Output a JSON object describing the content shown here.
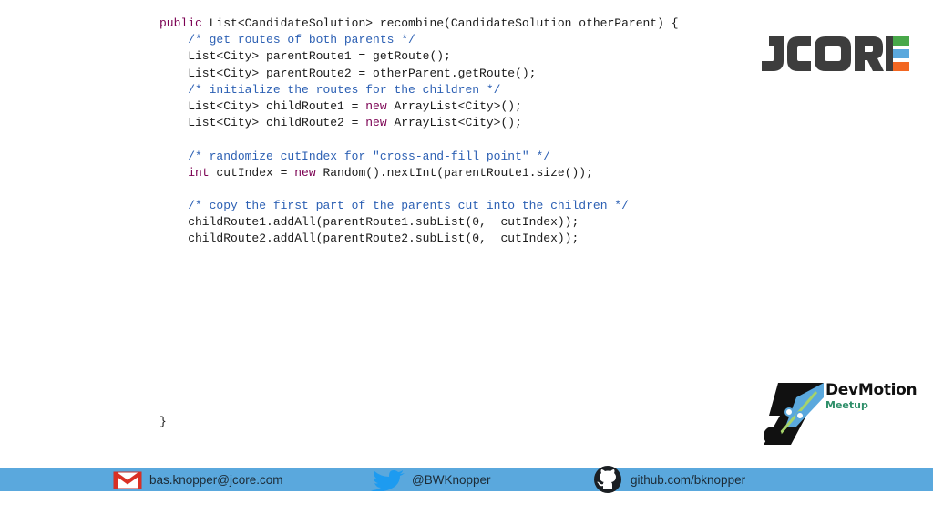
{
  "code": {
    "lines": [
      [
        {
          "t": "public",
          "c": "kw"
        },
        {
          "t": " List<CandidateSolution> recombine(CandidateSolution otherParent) {",
          "c": "tx"
        }
      ],
      [
        {
          "t": "    ",
          "c": "tx"
        },
        {
          "t": "/* get routes of both parents */",
          "c": "cm"
        }
      ],
      [
        {
          "t": "    List<City> parentRoute1 = getRoute();",
          "c": "tx"
        }
      ],
      [
        {
          "t": "    List<City> parentRoute2 = otherParent.getRoute();",
          "c": "tx"
        }
      ],
      [
        {
          "t": "    ",
          "c": "tx"
        },
        {
          "t": "/* initialize the routes for the children */",
          "c": "cm"
        }
      ],
      [
        {
          "t": "    List<City> childRoute1 = ",
          "c": "tx"
        },
        {
          "t": "new",
          "c": "kw"
        },
        {
          "t": " ArrayList<City>();",
          "c": "tx"
        }
      ],
      [
        {
          "t": "    List<City> childRoute2 = ",
          "c": "tx"
        },
        {
          "t": "new",
          "c": "kw"
        },
        {
          "t": " ArrayList<City>();",
          "c": "tx"
        }
      ],
      [],
      [
        {
          "t": "    ",
          "c": "tx"
        },
        {
          "t": "/* randomize cutIndex for \"cross-and-fill point\" */",
          "c": "cm"
        }
      ],
      [
        {
          "t": "    ",
          "c": "tx"
        },
        {
          "t": "int",
          "c": "kw"
        },
        {
          "t": " cutIndex = ",
          "c": "tx"
        },
        {
          "t": "new",
          "c": "kw"
        },
        {
          "t": " Random().nextInt(parentRoute1.size());",
          "c": "tx"
        }
      ],
      [],
      [
        {
          "t": "    ",
          "c": "tx"
        },
        {
          "t": "/* copy the first part of the parents cut into the children */",
          "c": "cm"
        }
      ],
      [
        {
          "t": "    childRoute1.addAll(parentRoute1.subList(0,  cutIndex));",
          "c": "tx"
        }
      ],
      [
        {
          "t": "    childRoute2.addAll(parentRoute2.subList(0,  cutIndex));",
          "c": "tx"
        }
      ],
      [],
      [],
      [],
      [],
      [],
      [],
      [],
      [],
      [],
      [],
      [
        {
          "t": "}",
          "c": "tx"
        }
      ]
    ]
  },
  "logos": {
    "jcore": {
      "text": "JCORE",
      "icon": "jcore-logo",
      "color": "#3d3d3d",
      "accent": "#f26722",
      "accent2": "#48a84a"
    },
    "devmotion": {
      "title": "DevMotion",
      "subtitle": "Meetup",
      "icon": "devmotion-logo"
    }
  },
  "footer": {
    "background": "#5aa8dd",
    "email": {
      "icon": "gmail-icon",
      "text": "bas.knopper@jcore.com"
    },
    "twitter": {
      "icon": "twitter-icon",
      "text": "@BWKnopper"
    },
    "github": {
      "icon": "github-icon",
      "text": "github.com/bknopper"
    }
  }
}
